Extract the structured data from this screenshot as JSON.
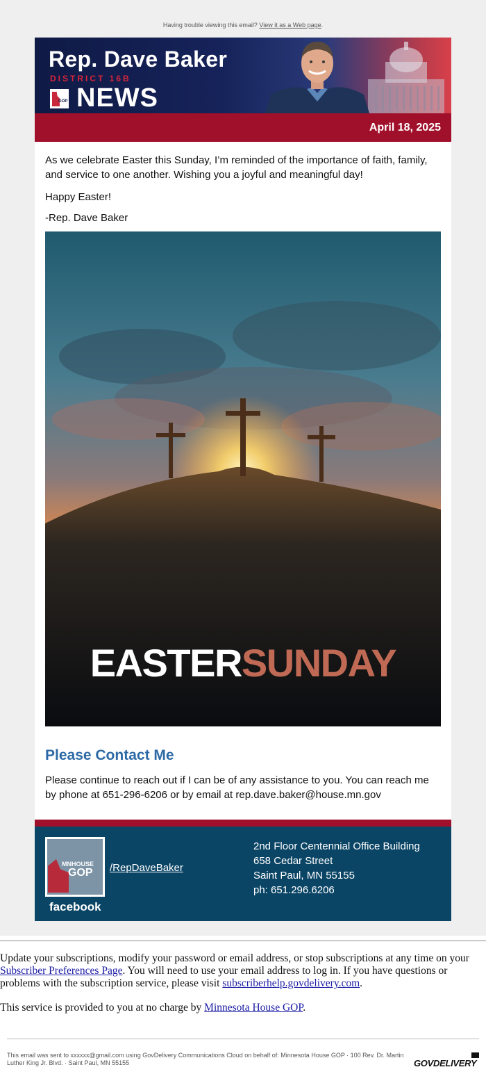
{
  "header": {
    "trouble_text": "Having trouble viewing this email?",
    "web_link": "View it as a Web page",
    "trouble_end": "."
  },
  "banner": {
    "name": "Rep. Dave Baker",
    "district": "DISTRICT 16B",
    "news": "NEWS",
    "logo_text": "GOP"
  },
  "date": "April 18, 2025",
  "body": {
    "para1": "As we celebrate Easter this Sunday, I’m reminded of the importance of faith, family, and service to one another. Wishing you a joyful and meaningful day!",
    "para2": "Happy Easter!",
    "para3": "-Rep. Dave Baker",
    "image_title_white": "EASTER",
    "image_title_color": "SUNDAY",
    "contact_heading": "Please Contact Me",
    "contact_text": "Please continue to reach out if I can be of any assistance to you. You can reach me by phone at 651-296-6206 or by email at rep.dave.baker@house.mn.gov"
  },
  "footer": {
    "logo_mnhouse": "MNHOUSE",
    "logo_gop": "GOP",
    "facebook": "facebook",
    "fb_link": "/RepDaveBaker",
    "address_line1": "2nd Floor Centennial Office Building",
    "address_line2": "658 Cedar Street",
    "address_line3": "Saint Paul, MN 55155",
    "address_line4": "ph: 651.296.6206"
  },
  "subscription": {
    "text1": "Update your subscriptions, modify your password or email address, or stop subscriptions at any time on your ",
    "prefs_link": "Subscriber Preferences Page",
    "text2": ". You will need to use your email address to log in. If you have questions or problems with the subscription service, please visit ",
    "help_link": "subscriberhelp.govdelivery.com",
    "text3": ".",
    "charge_text": "This service is provided to you at no charge by ",
    "charge_link": "Minnesota House GOP",
    "charge_end": "."
  },
  "legal": {
    "text": "This email was sent to xxxxxx@gmail.com using GovDelivery Communications Cloud on behalf of: Minnesota House GOP · 100 Rev. Dr. Martin Luther King Jr. Blvd. · Saint Paul, MN 55155",
    "brand": "GOVDELIVERY"
  },
  "colors": {
    "brand_red": "#a0102a",
    "navy": "#0f1a45",
    "footer_blue": "#0b4565",
    "heading_blue": "#2d6aa5"
  }
}
